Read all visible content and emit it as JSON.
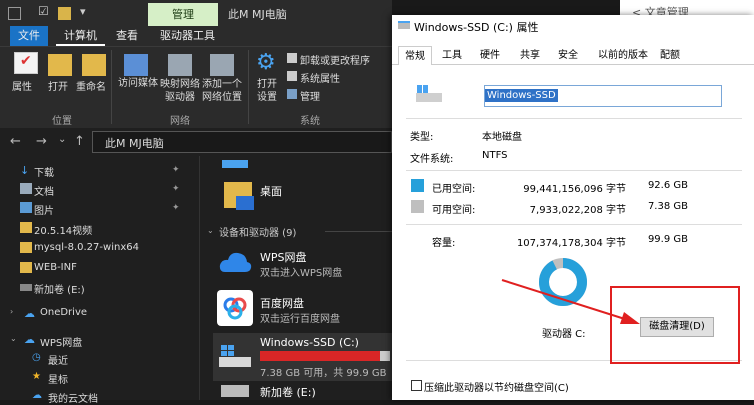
{
  "explorer": {
    "manage_tab": "管理",
    "window_title": "此M  MJ电脑",
    "menu": {
      "file": "文件",
      "computer": "计算机",
      "view": "查看",
      "drive_tools": "驱动器工具"
    },
    "ribbon": {
      "properties": "属性",
      "open": "打开",
      "rename": "重命名",
      "access_media": "访问媒体",
      "map_drive": "映射网络驱动器",
      "add_location": "添加一个网络位置",
      "open_settings": "打开设置",
      "uninstall": "卸载或更改程序",
      "sys_props": "系统属性",
      "manage": "管理",
      "group_location": "位置",
      "group_network": "网络",
      "group_system": "系统"
    },
    "address": "此M  MJ电脑",
    "nav_items": [
      {
        "label": "下载",
        "pinned": true
      },
      {
        "label": "文档",
        "pinned": true
      },
      {
        "label": "图片",
        "pinned": true
      },
      {
        "label": "20.5.14视频",
        "pinned": false
      },
      {
        "label": "mysql-8.0.27-winx64",
        "pinned": false
      },
      {
        "label": "WEB-INF",
        "pinned": false
      },
      {
        "label": "新加卷 (E:)",
        "pinned": false
      },
      {
        "label": "OneDrive",
        "pinned": false
      },
      {
        "label": "WPS网盘",
        "pinned": false
      },
      {
        "label": "最近",
        "pinned": false
      },
      {
        "label": "星标",
        "pinned": false
      },
      {
        "label": "我的云文档",
        "pinned": false
      }
    ],
    "pin_glyph": "✦",
    "desktop": "桌面",
    "devices_header": "设备和驱动器 (9)",
    "drives": [
      {
        "name": "WPS网盘",
        "sub": "双击进入WPS网盘"
      },
      {
        "name": "百度网盘",
        "sub": "双击运行百度网盘"
      },
      {
        "name": "Windows-SSD (C:)",
        "sub": "7.38 GB 可用，共 99.9 GB",
        "used_fraction": 0.926
      },
      {
        "name": "新加卷 (E:)",
        "sub": ""
      }
    ]
  },
  "dialog": {
    "title": "Windows-SSD (C:) 属性",
    "tabs": [
      "常规",
      "工具",
      "硬件",
      "共享",
      "安全",
      "以前的版本",
      "配额"
    ],
    "name_value": "Windows-SSD",
    "type_label": "类型:",
    "type_value": "本地磁盘",
    "fs_label": "文件系统:",
    "fs_value": "NTFS",
    "used_label": "已用空间:",
    "used_bytes": "99,441,156,096 字节",
    "used_gb": "92.6 GB",
    "free_label": "可用空间:",
    "free_bytes": "7,933,022,208 字节",
    "free_gb": "7.38 GB",
    "cap_label": "容量:",
    "cap_bytes": "107,374,178,304 字节",
    "cap_gb": "99.9 GB",
    "drive_label": "驱动器 C:",
    "cleanup": "磁盘清理(D)",
    "compress": "压缩此驱动器以节约磁盘空间(C)",
    "used_color": "#26a0da",
    "free_color": "#bfbfbf"
  },
  "background": {
    "tab": "< 文章管理"
  }
}
